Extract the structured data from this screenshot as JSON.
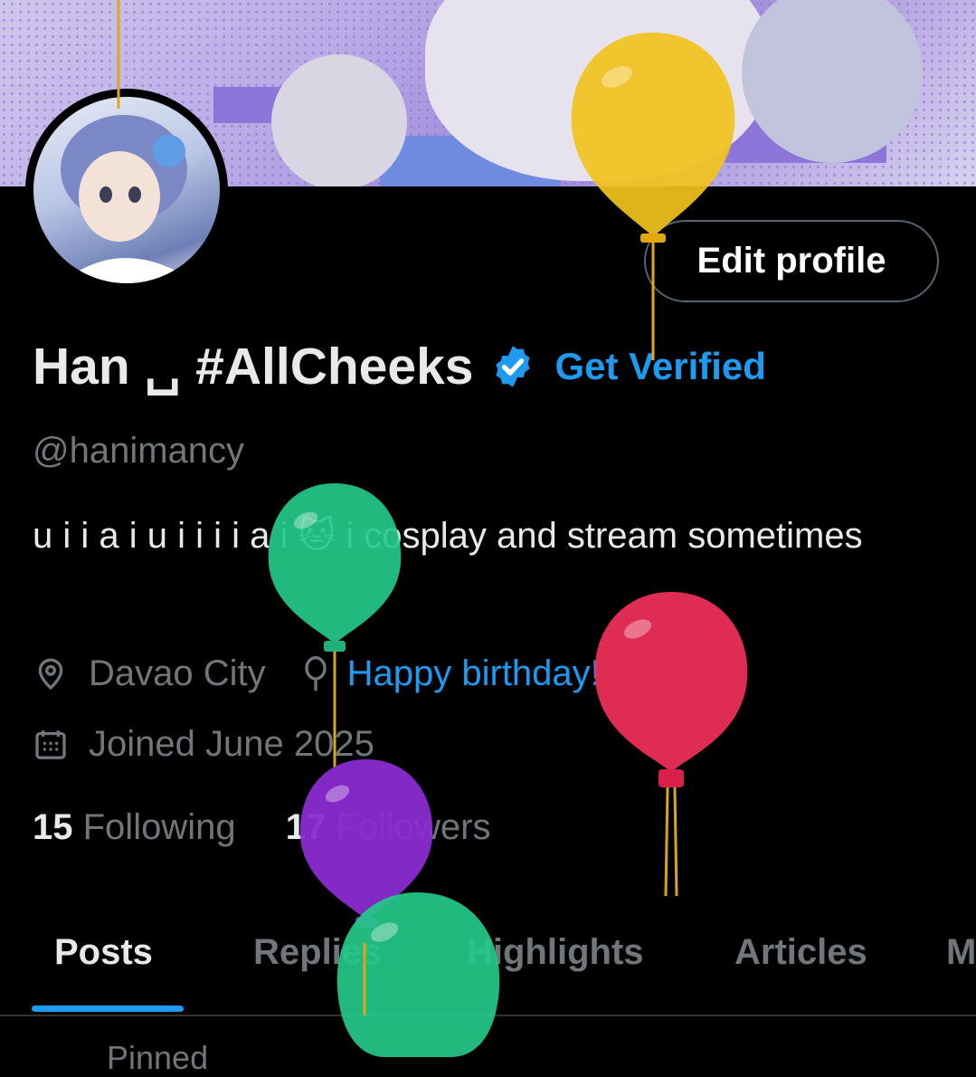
{
  "profile": {
    "display_name": "Han ␣ #AllCheeks",
    "get_verified": "Get Verified",
    "handle": "@hanimancy",
    "bio": "u i i a i u i i i i a i 🐱 i cosplay and stream sometimes",
    "location": "Davao City",
    "birthday": "Happy birthday!",
    "joined": "Joined June 2025",
    "following_count": "15",
    "following_label": "Following",
    "followers_count": "17",
    "followers_label": "Followers"
  },
  "actions": {
    "edit_profile": "Edit profile"
  },
  "tabs": [
    {
      "label": "Posts"
    },
    {
      "label": "Replies"
    },
    {
      "label": "Highlights"
    },
    {
      "label": "Articles"
    },
    {
      "label": "Media"
    }
  ],
  "pinned_label": "Pinned",
  "colors": {
    "accent": "#1d9bf0",
    "text_primary": "#e7e9ea",
    "text_secondary": "#71767b",
    "balloon_yellow": "#f2c21c",
    "balloon_green": "#25c98a",
    "balloon_red": "#ea2e57",
    "balloon_purple": "#8a2bd0"
  }
}
